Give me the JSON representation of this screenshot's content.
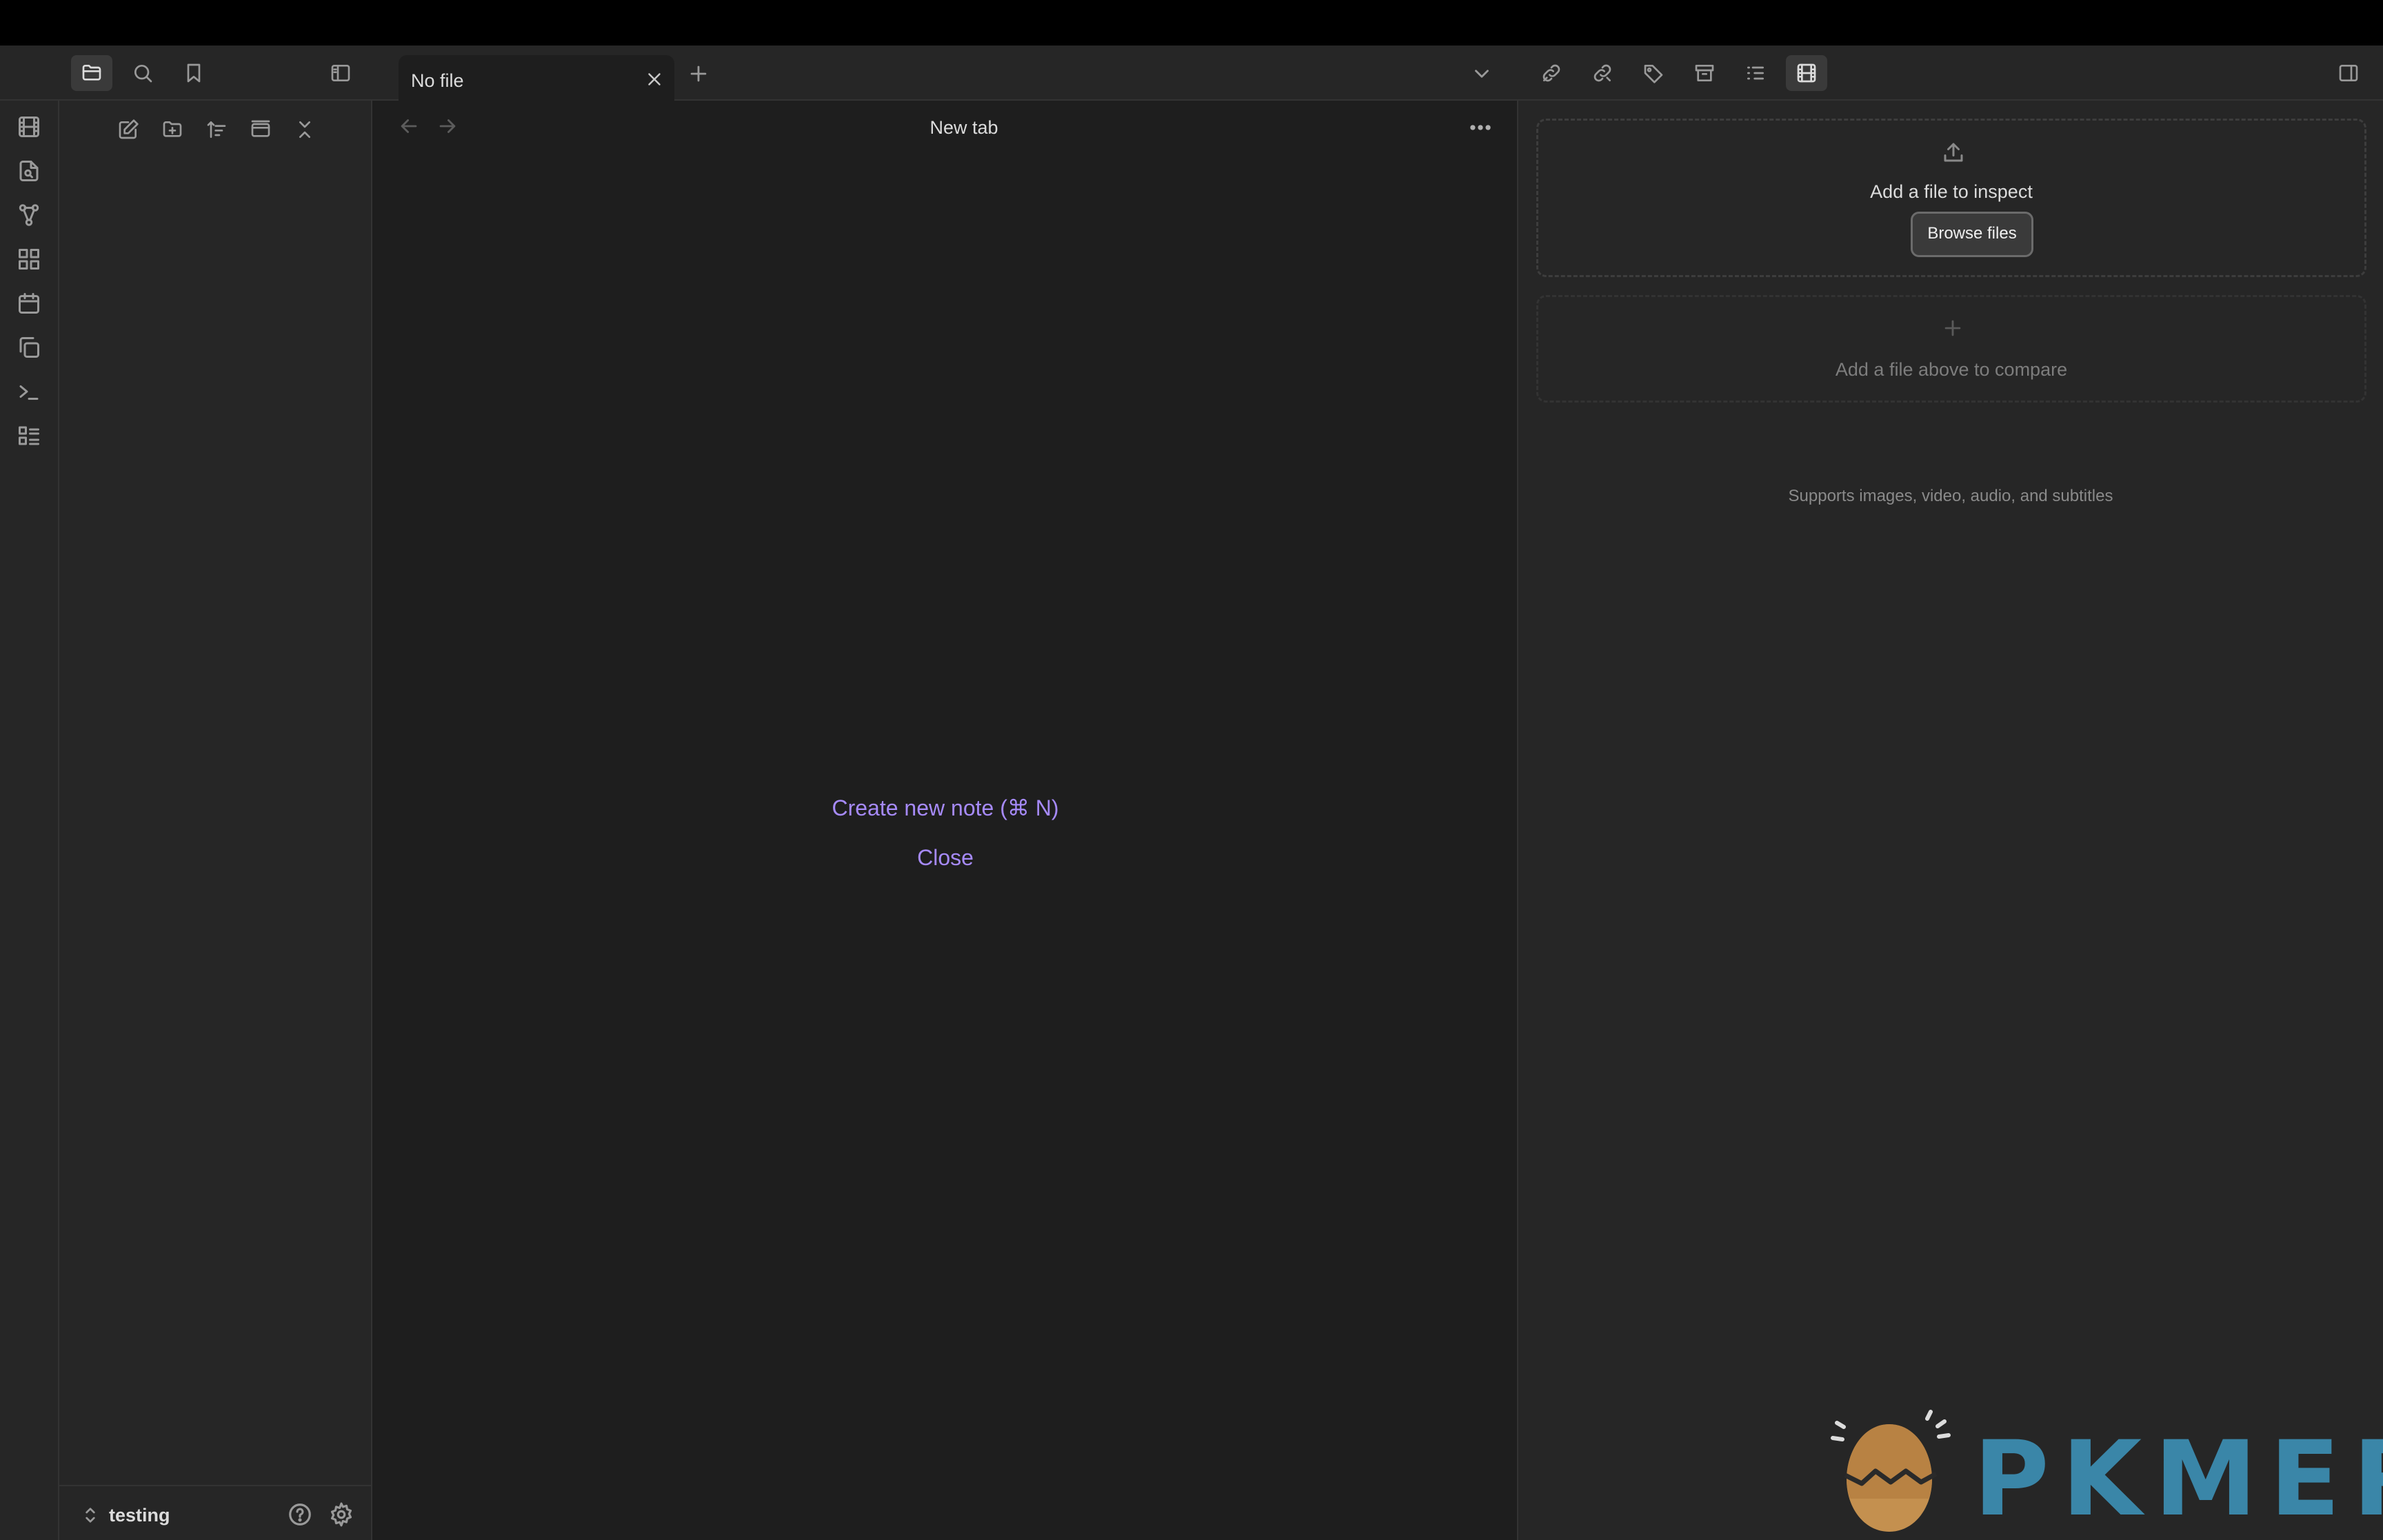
{
  "tabs": [
    {
      "title": "No file",
      "active": true
    }
  ],
  "main": {
    "view_title": "New tab",
    "actions": {
      "create_note": "Create new note (⌘ N)",
      "close": "Close"
    }
  },
  "inspector": {
    "drop_label": "Add a file to inspect",
    "browse_button": "Browse files",
    "compare_label": "Add a file above to compare",
    "supports_text": "Supports images, video, audio, and subtitles"
  },
  "vault": {
    "name": "testing"
  },
  "watermark": {
    "text": "PKMER"
  },
  "colors": {
    "accent": "#a68af9",
    "background": "#1e1e1e",
    "panel": "#262626",
    "watermark_blue": "#3a86a8"
  },
  "icons": {
    "ribbon": [
      "film-icon",
      "file-search-icon",
      "graph-icon",
      "dashboard-icon",
      "calendar-icon",
      "copy-icon",
      "terminal-icon",
      "checklist-icon"
    ],
    "sidebar_header": [
      "folder-icon",
      "search-icon",
      "bookmark-icon",
      "sidebar-toggle-icon"
    ],
    "sidebar_tools": [
      "new-note-icon",
      "new-folder-icon",
      "sort-icon",
      "collapse-all-icon",
      "close-chevron-icon"
    ],
    "right_header": [
      "outgoing-links-icon",
      "backlinks-icon",
      "tags-icon",
      "archive-icon",
      "outline-icon",
      "media-inspector-icon",
      "right-sidebar-toggle-icon"
    ]
  }
}
